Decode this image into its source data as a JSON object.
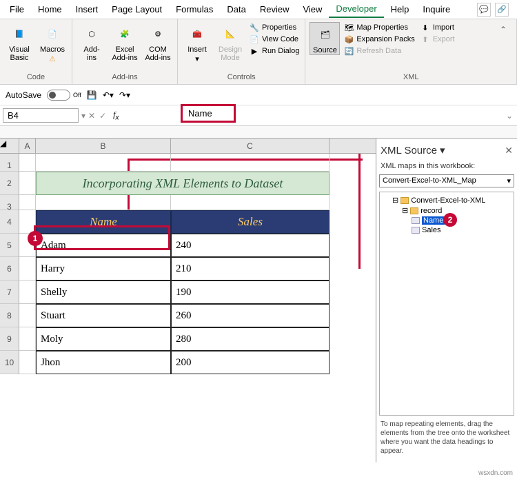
{
  "menu": {
    "tabs": [
      "File",
      "Home",
      "Insert",
      "Page Layout",
      "Formulas",
      "Data",
      "Review",
      "View",
      "Developer",
      "Help",
      "Inquire"
    ],
    "active": "Developer"
  },
  "ribbon": {
    "code": {
      "label": "Code",
      "visual_basic": "Visual\nBasic",
      "macros": "Macros"
    },
    "addins": {
      "label": "Add-ins",
      "addins": "Add-\nins",
      "excel_addins": "Excel\nAdd-ins",
      "com_addins": "COM\nAdd-ins"
    },
    "controls": {
      "label": "Controls",
      "insert": "Insert",
      "design": "Design\nMode",
      "properties": "Properties",
      "view_code": "View Code",
      "run_dialog": "Run Dialog"
    },
    "xml": {
      "label": "XML",
      "source": "Source",
      "map_props": "Map Properties",
      "expansion": "Expansion Packs",
      "refresh": "Refresh Data",
      "import": "Import",
      "export": "Export"
    }
  },
  "qat": {
    "autosave": "AutoSave",
    "off": "Off"
  },
  "formula_bar": {
    "cell_ref": "B4",
    "value": "Name"
  },
  "sheet": {
    "cols": [
      "A",
      "B",
      "C"
    ],
    "rows": [
      "1",
      "2",
      "3",
      "4",
      "5",
      "6",
      "7",
      "8",
      "9",
      "10"
    ],
    "title": "Incorporating XML Elements to Dataset",
    "headers": {
      "name": "Name",
      "sales": "Sales"
    },
    "data": [
      {
        "name": "Adam",
        "sales": "240"
      },
      {
        "name": "Harry",
        "sales": "210"
      },
      {
        "name": "Shelly",
        "sales": "190"
      },
      {
        "name": "Stuart",
        "sales": "260"
      },
      {
        "name": "Moly",
        "sales": "280"
      },
      {
        "name": "Jhon",
        "sales": "200"
      }
    ]
  },
  "xml_pane": {
    "title": "XML Source",
    "maps_label": "XML maps in this workbook:",
    "map_selected": "Convert-Excel-to-XML_Map",
    "root": "Convert-Excel-to-XML",
    "record": "record",
    "name_node": "Name",
    "sales_node": "Sales",
    "hint": "To map repeating elements, drag the elements from the tree onto the worksheet where you want the data headings to appear."
  },
  "callouts": {
    "one": "1",
    "two": "2"
  },
  "watermark": "wsxdn.com"
}
